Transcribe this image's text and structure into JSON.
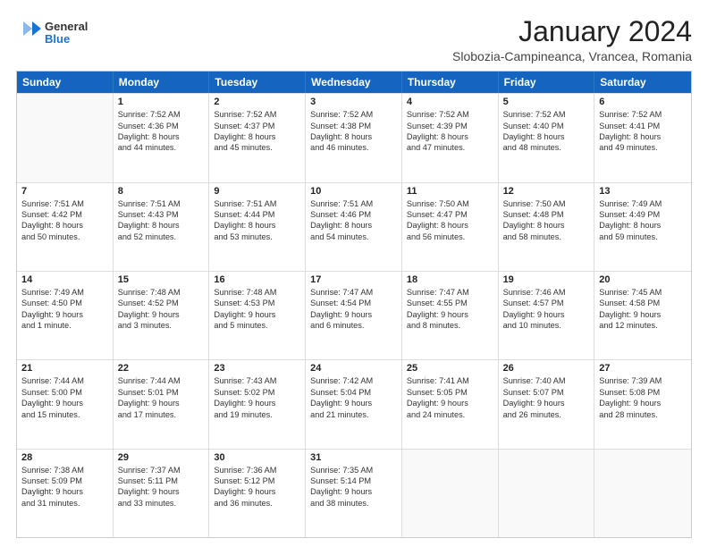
{
  "logo": {
    "general": "General",
    "blue": "Blue"
  },
  "header": {
    "month": "January 2024",
    "location": "Slobozia-Campineanca, Vrancea, Romania"
  },
  "weekdays": [
    "Sunday",
    "Monday",
    "Tuesday",
    "Wednesday",
    "Thursday",
    "Friday",
    "Saturday"
  ],
  "weeks": [
    [
      {
        "day": "",
        "lines": []
      },
      {
        "day": "1",
        "lines": [
          "Sunrise: 7:52 AM",
          "Sunset: 4:36 PM",
          "Daylight: 8 hours",
          "and 44 minutes."
        ]
      },
      {
        "day": "2",
        "lines": [
          "Sunrise: 7:52 AM",
          "Sunset: 4:37 PM",
          "Daylight: 8 hours",
          "and 45 minutes."
        ]
      },
      {
        "day": "3",
        "lines": [
          "Sunrise: 7:52 AM",
          "Sunset: 4:38 PM",
          "Daylight: 8 hours",
          "and 46 minutes."
        ]
      },
      {
        "day": "4",
        "lines": [
          "Sunrise: 7:52 AM",
          "Sunset: 4:39 PM",
          "Daylight: 8 hours",
          "and 47 minutes."
        ]
      },
      {
        "day": "5",
        "lines": [
          "Sunrise: 7:52 AM",
          "Sunset: 4:40 PM",
          "Daylight: 8 hours",
          "and 48 minutes."
        ]
      },
      {
        "day": "6",
        "lines": [
          "Sunrise: 7:52 AM",
          "Sunset: 4:41 PM",
          "Daylight: 8 hours",
          "and 49 minutes."
        ]
      }
    ],
    [
      {
        "day": "7",
        "lines": [
          "Sunrise: 7:51 AM",
          "Sunset: 4:42 PM",
          "Daylight: 8 hours",
          "and 50 minutes."
        ]
      },
      {
        "day": "8",
        "lines": [
          "Sunrise: 7:51 AM",
          "Sunset: 4:43 PM",
          "Daylight: 8 hours",
          "and 52 minutes."
        ]
      },
      {
        "day": "9",
        "lines": [
          "Sunrise: 7:51 AM",
          "Sunset: 4:44 PM",
          "Daylight: 8 hours",
          "and 53 minutes."
        ]
      },
      {
        "day": "10",
        "lines": [
          "Sunrise: 7:51 AM",
          "Sunset: 4:46 PM",
          "Daylight: 8 hours",
          "and 54 minutes."
        ]
      },
      {
        "day": "11",
        "lines": [
          "Sunrise: 7:50 AM",
          "Sunset: 4:47 PM",
          "Daylight: 8 hours",
          "and 56 minutes."
        ]
      },
      {
        "day": "12",
        "lines": [
          "Sunrise: 7:50 AM",
          "Sunset: 4:48 PM",
          "Daylight: 8 hours",
          "and 58 minutes."
        ]
      },
      {
        "day": "13",
        "lines": [
          "Sunrise: 7:49 AM",
          "Sunset: 4:49 PM",
          "Daylight: 8 hours",
          "and 59 minutes."
        ]
      }
    ],
    [
      {
        "day": "14",
        "lines": [
          "Sunrise: 7:49 AM",
          "Sunset: 4:50 PM",
          "Daylight: 9 hours",
          "and 1 minute."
        ]
      },
      {
        "day": "15",
        "lines": [
          "Sunrise: 7:48 AM",
          "Sunset: 4:52 PM",
          "Daylight: 9 hours",
          "and 3 minutes."
        ]
      },
      {
        "day": "16",
        "lines": [
          "Sunrise: 7:48 AM",
          "Sunset: 4:53 PM",
          "Daylight: 9 hours",
          "and 5 minutes."
        ]
      },
      {
        "day": "17",
        "lines": [
          "Sunrise: 7:47 AM",
          "Sunset: 4:54 PM",
          "Daylight: 9 hours",
          "and 6 minutes."
        ]
      },
      {
        "day": "18",
        "lines": [
          "Sunrise: 7:47 AM",
          "Sunset: 4:55 PM",
          "Daylight: 9 hours",
          "and 8 minutes."
        ]
      },
      {
        "day": "19",
        "lines": [
          "Sunrise: 7:46 AM",
          "Sunset: 4:57 PM",
          "Daylight: 9 hours",
          "and 10 minutes."
        ]
      },
      {
        "day": "20",
        "lines": [
          "Sunrise: 7:45 AM",
          "Sunset: 4:58 PM",
          "Daylight: 9 hours",
          "and 12 minutes."
        ]
      }
    ],
    [
      {
        "day": "21",
        "lines": [
          "Sunrise: 7:44 AM",
          "Sunset: 5:00 PM",
          "Daylight: 9 hours",
          "and 15 minutes."
        ]
      },
      {
        "day": "22",
        "lines": [
          "Sunrise: 7:44 AM",
          "Sunset: 5:01 PM",
          "Daylight: 9 hours",
          "and 17 minutes."
        ]
      },
      {
        "day": "23",
        "lines": [
          "Sunrise: 7:43 AM",
          "Sunset: 5:02 PM",
          "Daylight: 9 hours",
          "and 19 minutes."
        ]
      },
      {
        "day": "24",
        "lines": [
          "Sunrise: 7:42 AM",
          "Sunset: 5:04 PM",
          "Daylight: 9 hours",
          "and 21 minutes."
        ]
      },
      {
        "day": "25",
        "lines": [
          "Sunrise: 7:41 AM",
          "Sunset: 5:05 PM",
          "Daylight: 9 hours",
          "and 24 minutes."
        ]
      },
      {
        "day": "26",
        "lines": [
          "Sunrise: 7:40 AM",
          "Sunset: 5:07 PM",
          "Daylight: 9 hours",
          "and 26 minutes."
        ]
      },
      {
        "day": "27",
        "lines": [
          "Sunrise: 7:39 AM",
          "Sunset: 5:08 PM",
          "Daylight: 9 hours",
          "and 28 minutes."
        ]
      }
    ],
    [
      {
        "day": "28",
        "lines": [
          "Sunrise: 7:38 AM",
          "Sunset: 5:09 PM",
          "Daylight: 9 hours",
          "and 31 minutes."
        ]
      },
      {
        "day": "29",
        "lines": [
          "Sunrise: 7:37 AM",
          "Sunset: 5:11 PM",
          "Daylight: 9 hours",
          "and 33 minutes."
        ]
      },
      {
        "day": "30",
        "lines": [
          "Sunrise: 7:36 AM",
          "Sunset: 5:12 PM",
          "Daylight: 9 hours",
          "and 36 minutes."
        ]
      },
      {
        "day": "31",
        "lines": [
          "Sunrise: 7:35 AM",
          "Sunset: 5:14 PM",
          "Daylight: 9 hours",
          "and 38 minutes."
        ]
      },
      {
        "day": "",
        "lines": []
      },
      {
        "day": "",
        "lines": []
      },
      {
        "day": "",
        "lines": []
      }
    ]
  ]
}
